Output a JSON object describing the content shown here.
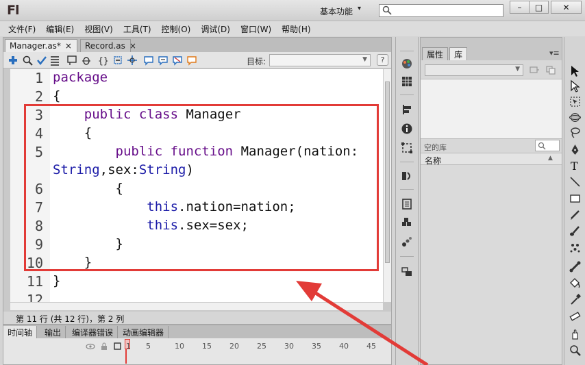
{
  "app": {
    "logo": "Fl",
    "workspace": "基本功能",
    "search": {
      "value": "",
      "placeholder": ""
    },
    "window_controls": {
      "minimize": "–",
      "maximize": "□",
      "close": "✕"
    }
  },
  "menu": [
    "文件(F)",
    "编辑(E)",
    "视图(V)",
    "工具(T)",
    "控制(O)",
    "调试(D)",
    "窗口(W)",
    "帮助(H)"
  ],
  "editor": {
    "tabs": [
      {
        "label": "Manager.as*",
        "active": true,
        "close": "×"
      },
      {
        "label": "Record.as",
        "active": false,
        "close": "×"
      }
    ],
    "toolbar": {
      "target_label": "目标:",
      "target_value": "",
      "icons": [
        "add-statement-icon",
        "find-icon",
        "check-syntax-icon",
        "auto-format-icon",
        "code-hint-icon",
        "debug-options-icon",
        "collapse-braces-icon",
        "collapse-selection-icon",
        "expand-all-icon",
        "apply-block-comment-icon",
        "apply-line-comment-icon",
        "remove-comment-icon",
        "script-assist-icon"
      ],
      "help": "?"
    },
    "line_numbers": [
      "1",
      "2",
      "3",
      "4",
      "5",
      "",
      "6",
      "7",
      "8",
      "9",
      "10",
      "11",
      "12"
    ],
    "code_lines": [
      {
        "indent": "",
        "parts": [
          {
            "t": "package",
            "c": "kw"
          }
        ]
      },
      {
        "indent": "",
        "parts": [
          {
            "t": "{",
            "c": ""
          }
        ]
      },
      {
        "indent": "    ",
        "parts": [
          {
            "t": "public",
            "c": "kw"
          },
          {
            "t": " ",
            "c": ""
          },
          {
            "t": "class",
            "c": "kw"
          },
          {
            "t": " Manager",
            "c": ""
          }
        ]
      },
      {
        "indent": "    ",
        "parts": [
          {
            "t": "{",
            "c": ""
          }
        ]
      },
      {
        "indent": "        ",
        "parts": [
          {
            "t": "public",
            "c": "kw"
          },
          {
            "t": " ",
            "c": ""
          },
          {
            "t": "function",
            "c": "kw"
          },
          {
            "t": " Manager(nation:",
            "c": ""
          }
        ]
      },
      {
        "indent": "",
        "parts": [
          {
            "t": "String",
            "c": "kwb"
          },
          {
            "t": ",sex:",
            "c": ""
          },
          {
            "t": "String",
            "c": "kwb"
          },
          {
            "t": ")",
            "c": ""
          }
        ]
      },
      {
        "indent": "        ",
        "parts": [
          {
            "t": "{",
            "c": ""
          }
        ]
      },
      {
        "indent": "            ",
        "parts": [
          {
            "t": "this",
            "c": "kwb"
          },
          {
            "t": ".nation=nation;",
            "c": ""
          }
        ]
      },
      {
        "indent": "            ",
        "parts": [
          {
            "t": "this",
            "c": "kwb"
          },
          {
            "t": ".sex=sex;",
            "c": ""
          }
        ]
      },
      {
        "indent": "        ",
        "parts": [
          {
            "t": "}",
            "c": ""
          }
        ]
      },
      {
        "indent": "    ",
        "parts": [
          {
            "t": "}",
            "c": ""
          }
        ]
      },
      {
        "indent": "",
        "parts": [
          {
            "t": "}",
            "c": ""
          }
        ]
      },
      {
        "indent": "",
        "parts": [
          {
            "t": "",
            "c": ""
          }
        ]
      }
    ],
    "status": "第 11 行 (共 12 行)，第 2 列"
  },
  "timeline": {
    "tabs": [
      "时间轴",
      "输出",
      "编译器错误",
      "动画编辑器"
    ],
    "frame_numbers": [
      "1",
      "5",
      "10",
      "15",
      "20",
      "25",
      "30",
      "35",
      "40",
      "45"
    ]
  },
  "properties": {
    "tabs": [
      "属性",
      "库"
    ],
    "library_select": "",
    "empty_library": "空的库",
    "column_name": "名称",
    "sort_icon": "▲"
  },
  "dock_icons": [
    "color-icon",
    "swatches-icon",
    "align-icon",
    "info-icon",
    "transform-icon",
    "code-snippets-icon",
    "components-icon",
    "component-inspector-icon",
    "motion-presets-icon",
    "movie-explorer-icon"
  ],
  "tool_icons": [
    "selection-tool-icon",
    "subselection-tool-icon",
    "free-transform-tool-icon",
    "3d-rotation-tool-icon",
    "lasso-tool-icon",
    "pen-tool-icon",
    "text-tool-icon",
    "line-tool-icon",
    "rectangle-tool-icon",
    "pencil-tool-icon",
    "brush-tool-icon",
    "deco-tool-icon",
    "bone-tool-icon",
    "paint-bucket-tool-icon",
    "eyedropper-tool-icon",
    "eraser-tool-icon",
    "hand-tool-icon",
    "zoom-tool-icon"
  ],
  "colors": {
    "highlight": "#e23b37",
    "keyword": "#660d89",
    "keyword_blue": "#1c1ca8"
  }
}
